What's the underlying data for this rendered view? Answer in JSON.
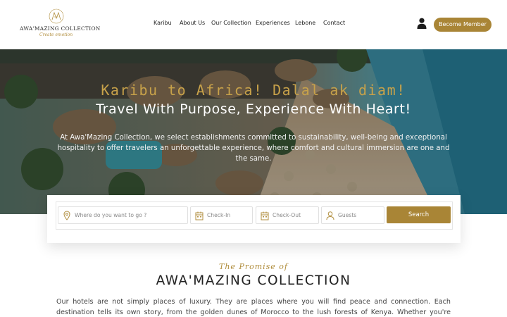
{
  "brand": {
    "name": "AWA'MAZING COLLECTION",
    "tagline": "Create emotion",
    "accent_color": "#a98536"
  },
  "nav": {
    "items": [
      "Karibu",
      "About Us",
      "Our Collection",
      "Experiences",
      "Lebone",
      "Contact"
    ],
    "user_icon": "user-icon",
    "cta_label": "Become Member"
  },
  "hero": {
    "greeting": "Karibu to Africa! Dalal ak diam!",
    "title": "Travel With Purpose, Experience With Heart!",
    "description": "At Awa'Mazing Collection, we select establishments committed to sustainability, well-being and exceptional hospitality to offer travelers an unforgettable experience, where comfort and cultural immersion are one and the same."
  },
  "search": {
    "destination_placeholder": "Where do you want to go ?",
    "checkin_placeholder": "Check-In",
    "checkout_placeholder": "Check-Out",
    "guests_placeholder": "Guests",
    "button_label": "Search",
    "icons": [
      "location-pin-icon",
      "calendar-icon",
      "calendar-icon",
      "user-icon"
    ]
  },
  "promise": {
    "script": "The Promise of",
    "title": "AWA'MAZING COLLECTION",
    "body": "Our hotels are not simply places of luxury. They are places where you will find peace and connection. Each destination tells its own story, from the golden dunes of Morocco to the lush forests of Kenya. Whether you're sipping tea under a centuries-old tree,"
  }
}
